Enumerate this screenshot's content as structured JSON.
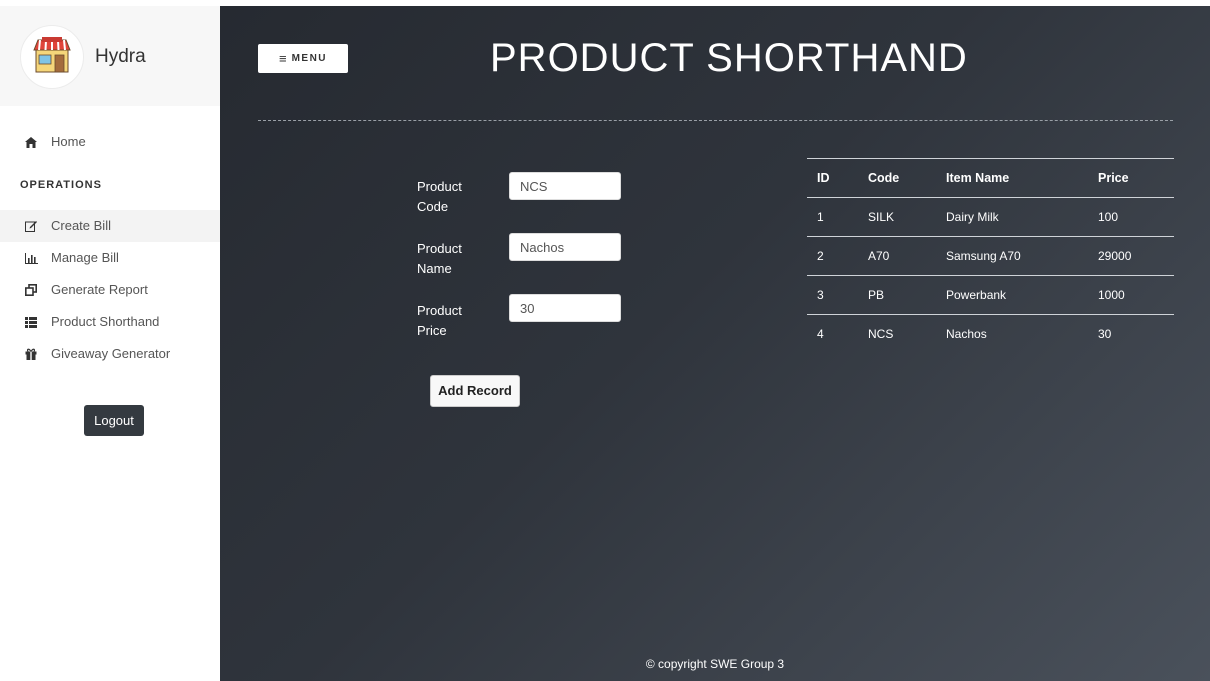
{
  "sidebar": {
    "brand": "Hydra",
    "home_label": "Home",
    "section_label": "OPERATIONS",
    "items": [
      {
        "label": "Create Bill",
        "icon": "edit-icon"
      },
      {
        "label": "Manage Bill",
        "icon": "bar-chart-icon"
      },
      {
        "label": "Generate Report",
        "icon": "clone-icon"
      },
      {
        "label": "Product Shorthand",
        "icon": "list-icon"
      },
      {
        "label": "Giveaway Generator",
        "icon": "gift-icon"
      }
    ],
    "active_item": "Create Bill",
    "logout_label": "Logout"
  },
  "header": {
    "menu_label": "MENU",
    "title": "PRODUCT SHORTHAND"
  },
  "form": {
    "code_label": "Product Code",
    "code_value": "NCS",
    "name_label": "Product Name",
    "name_value": "Nachos",
    "price_label": "Product Price",
    "price_value": "30",
    "add_label": "Add Record"
  },
  "table": {
    "headers": [
      "ID",
      "Code",
      "Item Name",
      "Price"
    ],
    "rows": [
      [
        "1",
        "SILK",
        "Dairy Milk",
        "100"
      ],
      [
        "2",
        "A70",
        "Samsung A70",
        "29000"
      ],
      [
        "3",
        "PB",
        "Powerbank",
        "1000"
      ],
      [
        "4",
        "NCS",
        "Nachos",
        "30"
      ]
    ]
  },
  "footer": "© copyright SWE Group 3",
  "colors": {
    "main_bg": "#2f343c",
    "button_dark": "#343a40"
  }
}
